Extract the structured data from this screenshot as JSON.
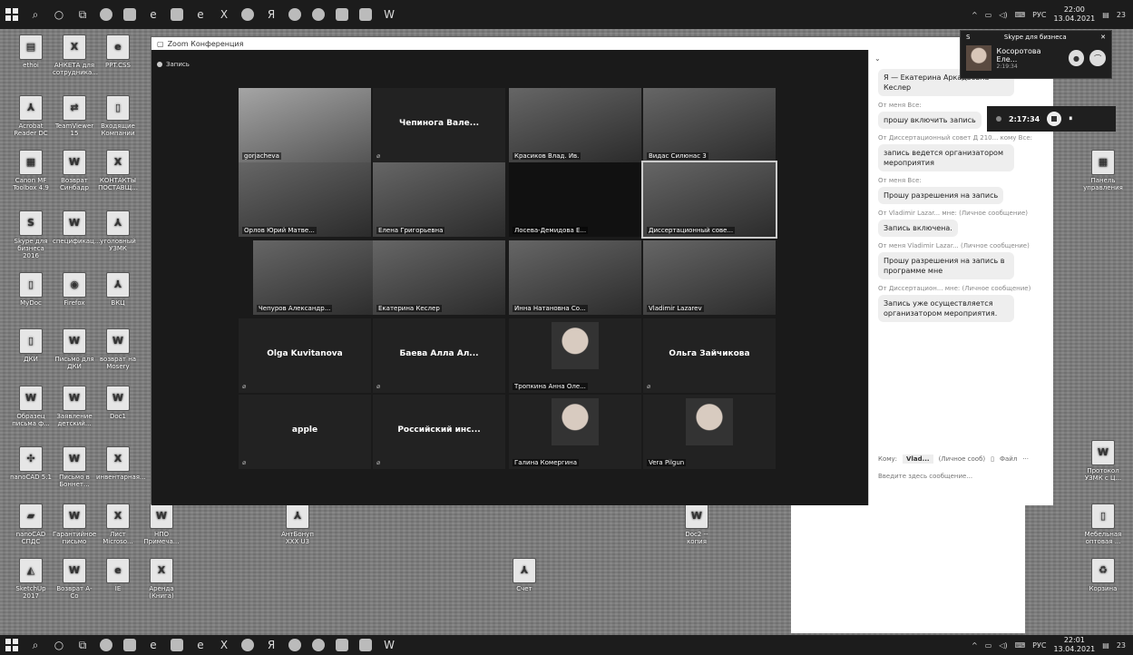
{
  "tray": {
    "lang": "РУС",
    "time_top": "22:00",
    "date_top": "13.04.2021",
    "time_bot": "22:01",
    "date_bot": "13.04.2021",
    "badge": "23"
  },
  "desktop_icons": [
    {
      "label": "ethoi",
      "glyph": "▤"
    },
    {
      "label": "АНКЕТА для сотрудника...",
      "glyph": "X"
    },
    {
      "label": "PPT.CSS",
      "glyph": "e"
    },
    {
      "label": "Acrobat Reader DC",
      "glyph": "⅄"
    },
    {
      "label": "TeamViewer 15",
      "glyph": "⇄"
    },
    {
      "label": "Входящие Компании",
      "glyph": "▯"
    },
    {
      "label": "Canon MF Toolbox 4.9",
      "glyph": "▦"
    },
    {
      "label": "Возврат Синбадр",
      "glyph": "W"
    },
    {
      "label": "КОНТАКТЫ ПОСТАВЩ...",
      "glyph": "X"
    },
    {
      "label": "Skype для бизнеса 2016",
      "glyph": "S"
    },
    {
      "label": "спецификац...",
      "glyph": "W"
    },
    {
      "label": "уголовный УЗМК",
      "glyph": "⅄"
    },
    {
      "label": "MyDoc",
      "glyph": "▯"
    },
    {
      "label": "Firefox",
      "glyph": "◉"
    },
    {
      "label": "ВКЦ",
      "glyph": "⅄"
    },
    {
      "label": "ДКИ",
      "glyph": "▯"
    },
    {
      "label": "Письмо для ДКИ",
      "glyph": "W"
    },
    {
      "label": "возврат на Mosery",
      "glyph": "W"
    },
    {
      "label": "Образец письма ф...",
      "glyph": "W"
    },
    {
      "label": "Заявление детский...",
      "glyph": "W"
    },
    {
      "label": "Doc1",
      "glyph": "W"
    },
    {
      "label": "nanoCAD 5.1",
      "glyph": "✣"
    },
    {
      "label": "Письмо в Боннет...",
      "glyph": "W"
    },
    {
      "label": "инвентарная...",
      "glyph": "X"
    },
    {
      "label": "nanoCAD СПДС",
      "glyph": "▰"
    },
    {
      "label": "Гарантийное письмо",
      "glyph": "W"
    },
    {
      "label": "Лист Microsо...",
      "glyph": "X"
    },
    {
      "label": "НПО Примеча...",
      "glyph": "W"
    },
    {
      "label": "SketchUp 2017",
      "glyph": "◭"
    },
    {
      "label": "Возврат А-Сo",
      "glyph": "W"
    },
    {
      "label": "IE",
      "glyph": "e"
    },
    {
      "label": "Аренда (Книга)",
      "glyph": "X"
    },
    {
      "label": "АнтБонуп XXX U3",
      "glyph": "⅄"
    },
    {
      "label": "Doc2 -- копия",
      "glyph": "W"
    },
    {
      "label": "Счет",
      "glyph": "⅄"
    },
    {
      "label": "Панель управления",
      "glyph": "▦"
    },
    {
      "label": "Протокол УЗМК с Ц...",
      "glyph": "W"
    },
    {
      "label": "Мебельная оптовая ...",
      "glyph": "▯"
    },
    {
      "label": "Корзина",
      "glyph": "♻"
    }
  ],
  "zoom": {
    "title": "Zoom Конференция",
    "recording": "Запись",
    "tiles": [
      {
        "name": "gorjacheva",
        "type": "video"
      },
      {
        "name": "Чепинога Вале...",
        "type": "name"
      },
      {
        "name": "Красиков Влад. Ив.",
        "type": "video"
      },
      {
        "name": "Видас Силюнас 3",
        "type": "video"
      },
      {
        "name": "Орлов Юрий Матве...",
        "type": "video"
      },
      {
        "name": "Елена Григорьевна",
        "type": "video"
      },
      {
        "name": "Лосева-Демидова Е...",
        "type": "dark"
      },
      {
        "name": "Диссертационный сове...",
        "type": "video"
      },
      {
        "name": "Чепуров Александр...",
        "type": "video"
      },
      {
        "name": "Екатерина Кеслер",
        "type": "video"
      },
      {
        "name": "Инна Натановна Со...",
        "type": "video"
      },
      {
        "name": "Vladimir Lazarev",
        "type": "video"
      },
      {
        "name": "Olga Kuvitanova",
        "type": "name"
      },
      {
        "name": "Баева Алла Ал...",
        "type": "name"
      },
      {
        "name": "Тропкина Анна Оле...",
        "type": "photo"
      },
      {
        "name": "Ольга Зайчикова",
        "type": "name"
      },
      {
        "name": "apple",
        "type": "name"
      },
      {
        "name": "Российский инс...",
        "type": "name"
      },
      {
        "name": "Галина Комергина",
        "type": "photo"
      },
      {
        "name": "Vera Pilgun",
        "type": "photo"
      }
    ]
  },
  "chat": {
    "header": "Ча",
    "messages": [
      {
        "meta": "",
        "text": "Я — Екатерина Аркадьевна Кеслер"
      },
      {
        "meta": "От меня Все:",
        "text": "прошу включить запись"
      },
      {
        "meta": "От Диссертационный совет Д 210... кому Все:",
        "text": "запись ведется организатором мероприятия"
      },
      {
        "meta": "От меня Все:",
        "text": "Прошу разрешения на запись"
      },
      {
        "meta": "От Vladimir Lazar... мне: (Личное сообщение)",
        "text": "Запись включена."
      },
      {
        "meta": "От меня Vladimir Lazar... (Личное сообщение)",
        "text": "Прошу разрешения на запись в программе мне"
      },
      {
        "meta": "От Диссертацион... мне: (Личное сообщение)",
        "text": "Запись уже осуществляется организатором мероприятия."
      }
    ],
    "to_label": "Кому:",
    "to_value": "Vlad...",
    "private": "(Личное сооб)",
    "file": "Файл",
    "placeholder": "Введите здесь сообщение..."
  },
  "skype": {
    "title": "Skype для бизнеса",
    "name": "Косоротова Еле...",
    "time": "2:19:34"
  },
  "recbar": {
    "time": "2:17:34"
  }
}
